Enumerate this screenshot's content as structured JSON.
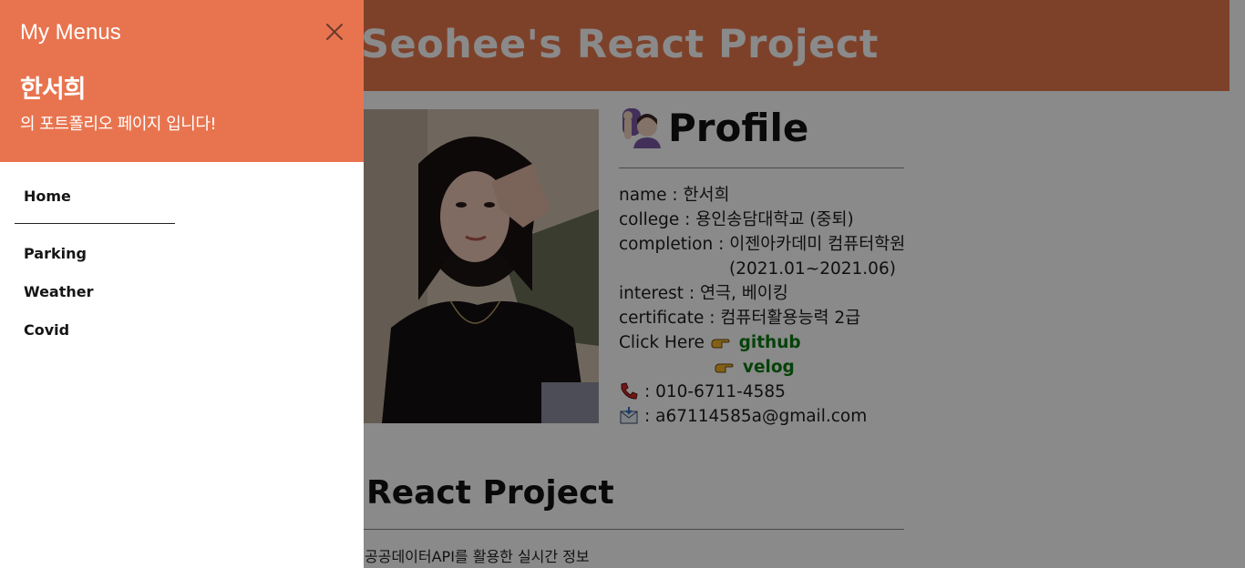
{
  "header": {
    "title": "Seohee's React Project"
  },
  "profile": {
    "title": "Profile",
    "rows": [
      "name : 한서희",
      "college : 용인송담대학교 (중퇴)",
      "completion : 이젠아카데미 컴퓨터학원",
      "(2021.01~2021.06)",
      "interest : 연극, 베이킹",
      "certificate : 컴퓨터활용능력 2급"
    ],
    "click_label": "Click Here",
    "github": "github",
    "velog": "velog",
    "phone": ": 010-6711-4585",
    "email": ": a67114585a@gmail.com"
  },
  "react": {
    "title": "React Project",
    "description": "공공데이터API를 활용한 실시간 정보"
  },
  "drawer": {
    "title": "My Menus",
    "name": "한서희",
    "subtitle": "의 포트폴리오 페이지 입니다!",
    "menu": [
      "Home",
      "Parking",
      "Weather",
      "Covid"
    ]
  },
  "colors": {
    "accent": "#e8744f",
    "link_green": "#0b7a12"
  },
  "icons": {
    "close": "close-icon",
    "raising_hand": "person-raising-hand-icon",
    "pointing": "pointing-hand-icon",
    "phone": "telephone-icon",
    "mail": "envelope-icon"
  }
}
